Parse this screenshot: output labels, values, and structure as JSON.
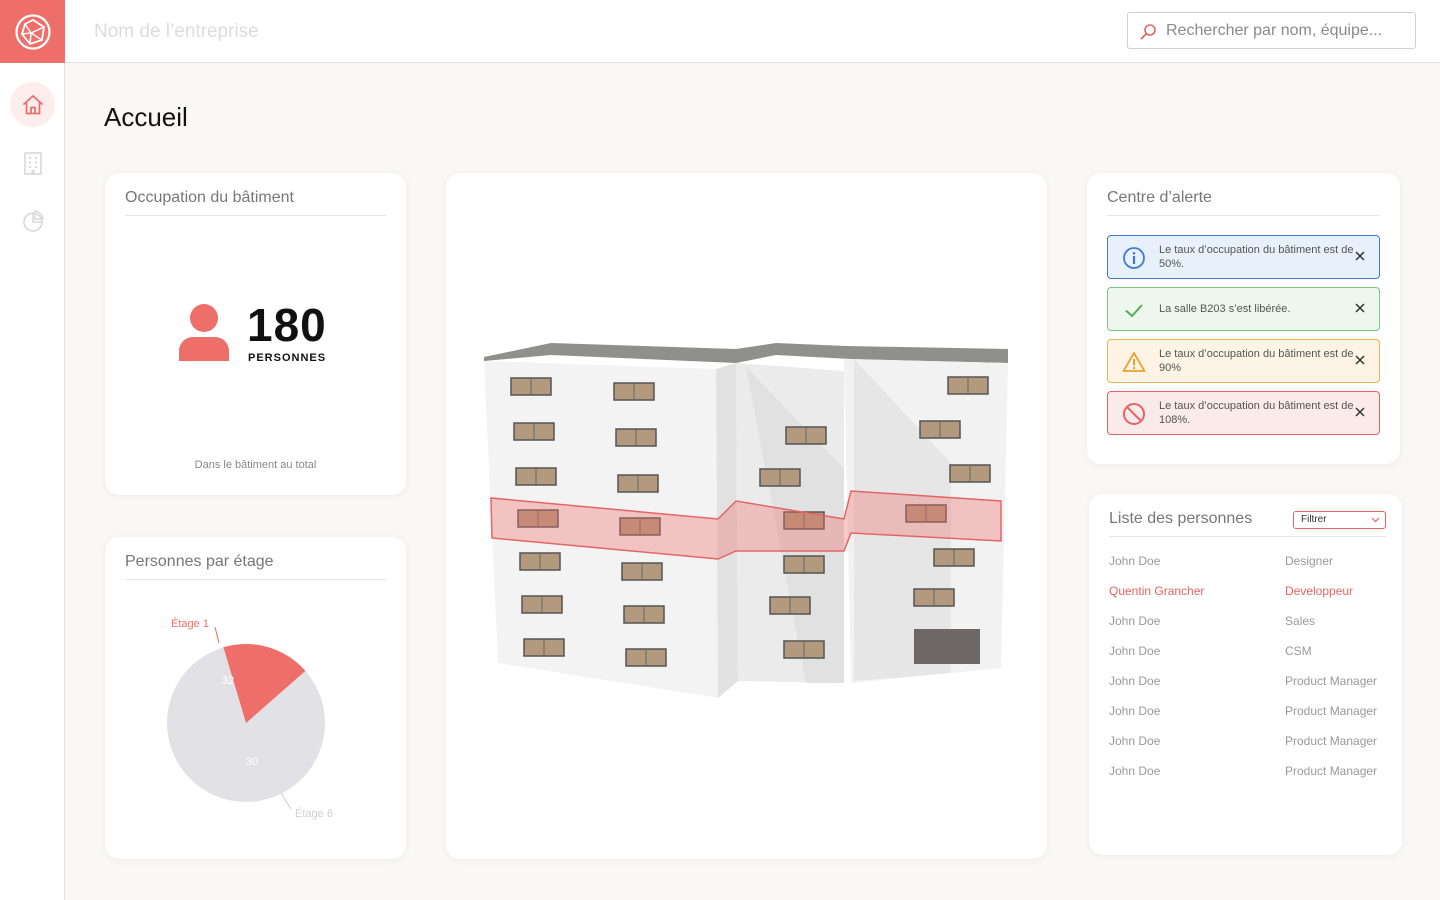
{
  "header": {
    "company_name": "Nom de l’entreprise",
    "search_placeholder": "Rechercher par nom, équipe..."
  },
  "sidebar": {
    "items": [
      {
        "icon": "home-icon",
        "active": true
      },
      {
        "icon": "building-icon",
        "active": false
      },
      {
        "icon": "pie-chart-icon",
        "active": false
      }
    ]
  },
  "page": {
    "title": "Accueil"
  },
  "occupancy": {
    "title": "Occupation du bâtiment",
    "value": "180",
    "unit": "PERSONNES",
    "footnote": "Dans le bâtiment au total"
  },
  "floors": {
    "title": "Personnes par étage",
    "chart_data": {
      "type": "pie",
      "slices": [
        {
          "label": "Étage 1",
          "value": 32,
          "color": "#ee6e6a"
        },
        {
          "label": "Étage 6",
          "value": 30,
          "color": "#e2e1e5"
        }
      ]
    }
  },
  "alerts": {
    "title": "Centre d’alerte",
    "items": [
      {
        "type": "info",
        "text": "Le taux d’occupation du bâtiment est de 50%.",
        "color": "#3f7bd1"
      },
      {
        "type": "success",
        "text": "La salle B203 s’est libérée.",
        "color": "#4caf50"
      },
      {
        "type": "warning",
        "text": "Le taux d’occupation du bâtiment est de 90%",
        "color": "#f0a030"
      },
      {
        "type": "error",
        "text": "Le taux d’occupation du bâtiment est de 108%.",
        "color": "#e56464"
      }
    ]
  },
  "people": {
    "title": "Liste des personnes",
    "filter_label": "Filtrer",
    "rows": [
      {
        "name": "John Doe",
        "role": "Designer",
        "highlight": false
      },
      {
        "name": "Quentin Grancher",
        "role": "Developpeur",
        "highlight": true
      },
      {
        "name": "John Doe",
        "role": "Sales",
        "highlight": false
      },
      {
        "name": "John Doe",
        "role": "CSM",
        "highlight": false
      },
      {
        "name": "John Doe",
        "role": "Product Manager",
        "highlight": false
      },
      {
        "name": "John Doe",
        "role": "Product Manager",
        "highlight": false
      },
      {
        "name": "John Doe",
        "role": "Product Manager",
        "highlight": false
      },
      {
        "name": "John Doe",
        "role": "Product Manager",
        "highlight": false
      }
    ]
  },
  "colors": {
    "brand": "#ee6e6a",
    "background": "#faf8f7"
  }
}
